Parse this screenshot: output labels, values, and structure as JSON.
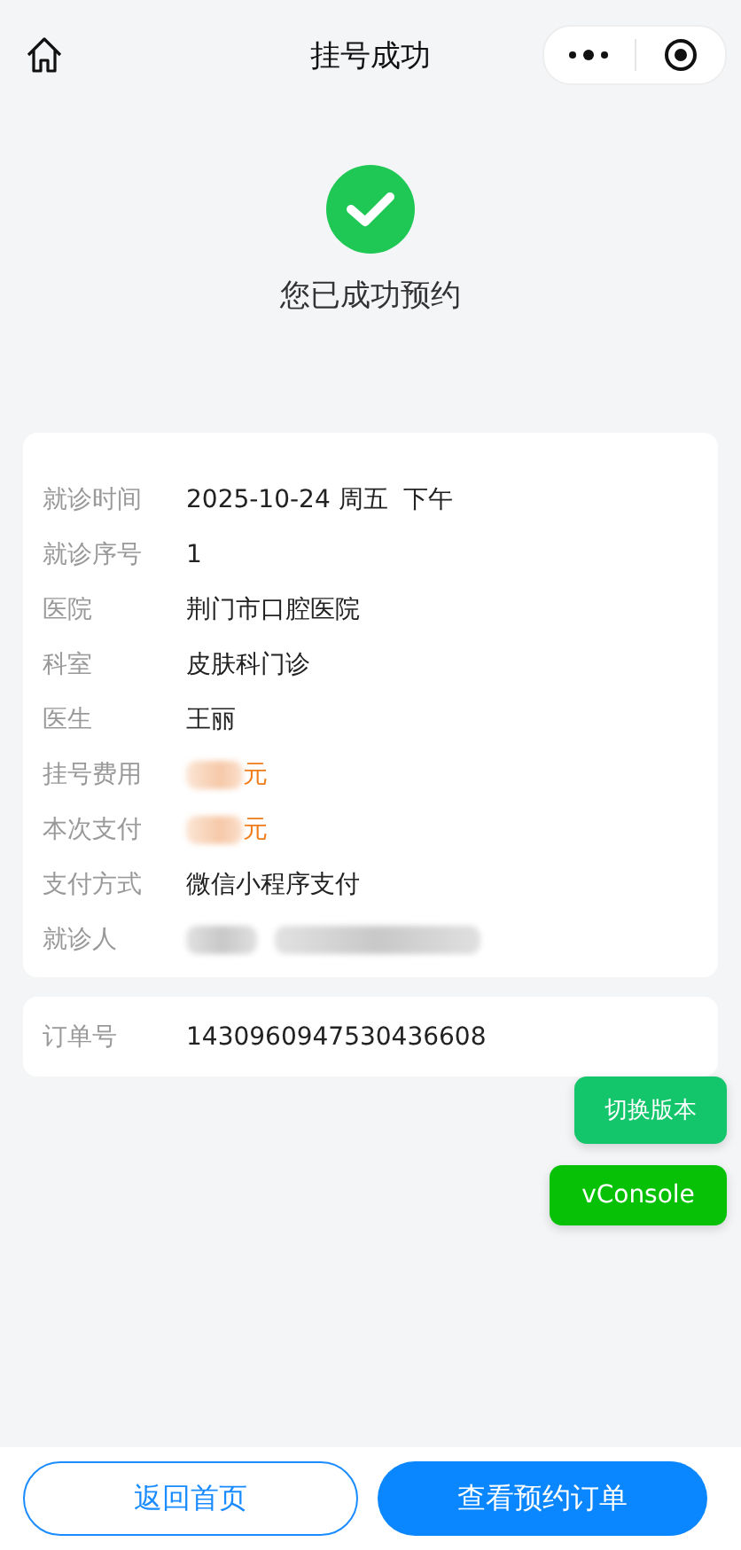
{
  "nav_bar": {
    "title": "挂号成功"
  },
  "result": {
    "message": "您已成功预约"
  },
  "details": [
    {
      "label": "就诊时间",
      "value": "2025-10-24 周五  下午",
      "kind": "text"
    },
    {
      "label": "就诊序号",
      "value": "1",
      "kind": "text"
    },
    {
      "label": "医院",
      "value": "荆门市口腔医院",
      "kind": "text"
    },
    {
      "label": "科室",
      "value": "皮肤科门诊",
      "kind": "text"
    },
    {
      "label": "医生",
      "value": "王丽",
      "kind": "text"
    },
    {
      "label": "挂号费用",
      "value": "元",
      "kind": "amount"
    },
    {
      "label": "本次支付",
      "value": "元",
      "kind": "amount"
    },
    {
      "label": "支付方式",
      "value": "微信小程序支付",
      "kind": "text"
    },
    {
      "label": "就诊人",
      "kind": "redacted"
    }
  ],
  "order": {
    "label": "订单号",
    "value": "1430960947530436608"
  },
  "floating_buttons": [
    {
      "label": "切换版本",
      "kind": "switch"
    },
    {
      "label": "vConsole",
      "kind": "console"
    }
  ],
  "bottom_buttons": [
    {
      "label": "返回首页",
      "kind": "outline"
    },
    {
      "label": "查看预约订单",
      "kind": "primary"
    }
  ]
}
